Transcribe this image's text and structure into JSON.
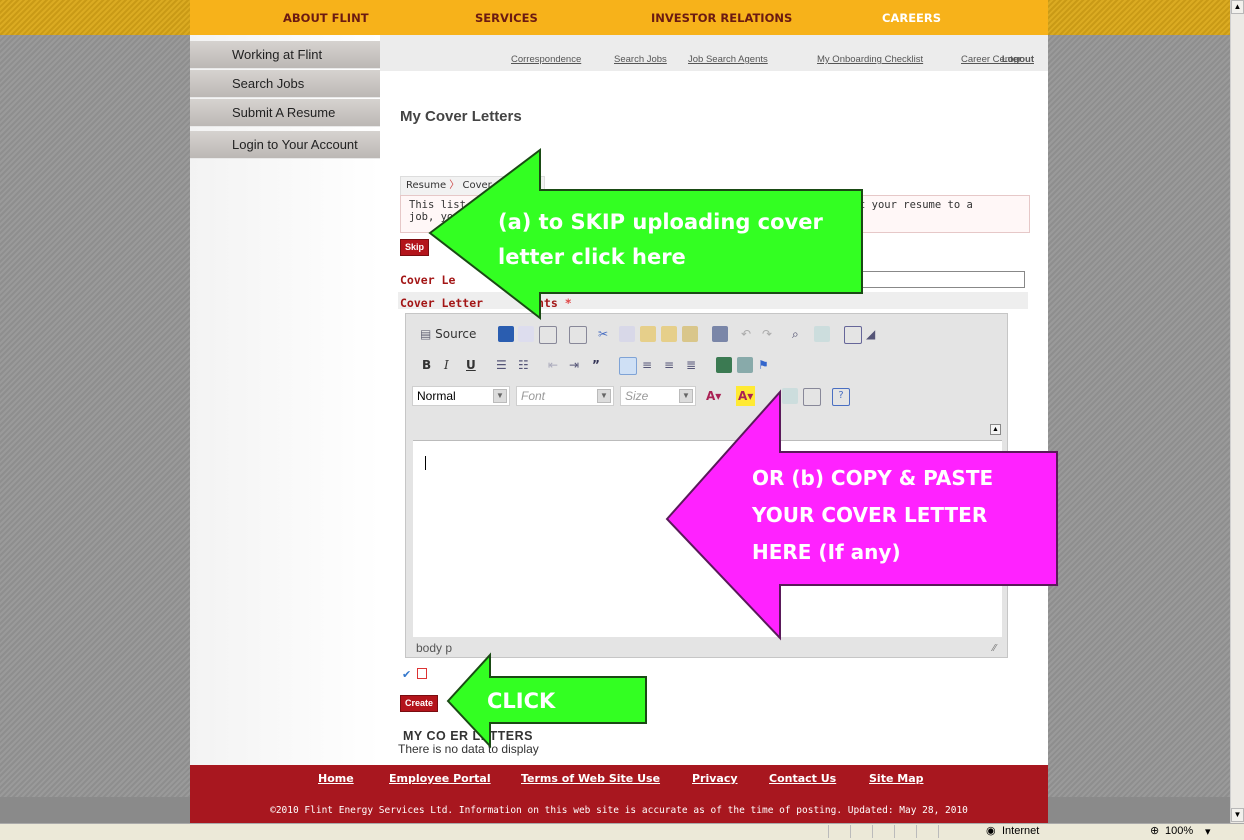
{
  "top_nav": {
    "items": [
      "ABOUT FLINT",
      "SERVICES",
      "INVESTOR RELATIONS",
      "CAREERS"
    ]
  },
  "left_nav": {
    "items": [
      "Working at Flint",
      "Search Jobs",
      "Submit A Resume",
      "Login to Your Account"
    ]
  },
  "sub_nav": {
    "logout": "Logout",
    "links": [
      "Correspondence",
      "Search Jobs",
      "Job Search Agents",
      "My Onboarding Checklist",
      "Career Center"
    ]
  },
  "page_title": "My Cover Letters",
  "breadcrumb": {
    "step1": "Resume",
    "step2": "Cover"
  },
  "info_text": {
    "line1a": "This list di",
    "line1b": "t your resume to a",
    "line2": "job, you"
  },
  "skip_button": "Skip",
  "form": {
    "name_label": "Cover Le",
    "contents_label_a": "Cover Letter",
    "contents_label_b": "nts",
    "required_mark": "*"
  },
  "editor": {
    "source_label": "Source",
    "format_value": "Normal",
    "font_placeholder": "Font",
    "size_placeholder": "Size",
    "path": "body  p"
  },
  "create_button": "Create",
  "my_cover_letters": "MY CO      ER LETTERS",
  "no_data": "There is no data to display",
  "footer": {
    "links": [
      "Home",
      "Employee Portal",
      "Terms of Web Site Use",
      "Privacy",
      "Contact Us",
      "Site Map"
    ],
    "copyright": "©2010 Flint Energy Services Ltd. Information on this web site is accurate as of the time of posting. Updated: May 28, 2010"
  },
  "annotations": {
    "skip_arrow": {
      "line1": "(a) to SKIP uploading cover",
      "line2": "letter click here",
      "color": "#33ff22"
    },
    "paste_arrow": {
      "line1": "OR (b) COPY & PASTE",
      "line2": "YOUR COVER LETTER",
      "line3": "HERE (If any)",
      "color": "#ff22ff"
    },
    "click_arrow": {
      "label": "CLICK",
      "color": "#33ff22"
    }
  },
  "status_bar": {
    "zone": "Internet",
    "zoom": "100%"
  },
  "colors": {
    "nav_gold": "#f7b21a",
    "footer_red": "#a8171f",
    "button_red": "#b3141b"
  }
}
